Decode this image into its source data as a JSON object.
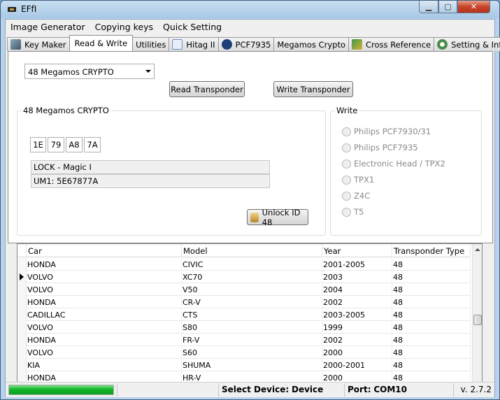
{
  "window": {
    "title": "EFfI"
  },
  "menu": {
    "items": [
      "Image Generator",
      "Copying keys",
      "Quick Setting"
    ]
  },
  "tabs": [
    {
      "label": "Key Maker",
      "icon": "keymaker-icon",
      "active": false
    },
    {
      "label": "Read & Write",
      "icon": "",
      "active": true
    },
    {
      "label": "Utilities",
      "icon": "",
      "active": false
    },
    {
      "label": "Hitag II",
      "icon": "hitag-icon",
      "active": false
    },
    {
      "label": "PCF7935",
      "icon": "pcf-icon",
      "active": false
    },
    {
      "label": "Megamos Crypto",
      "icon": "",
      "active": false
    },
    {
      "label": "Cross Reference",
      "icon": "cross-reference-icon",
      "active": false
    },
    {
      "label": "Setting & Info",
      "icon": "gear-icon",
      "active": false
    }
  ],
  "read_write": {
    "transponder_select": "48 Megamos CRYPTO",
    "read_button": "Read Transponder",
    "write_button": "Write Transponder",
    "info_group": {
      "title": "48 Megamos CRYPTO",
      "bytes": [
        "1E",
        "79",
        "A8",
        "7A"
      ],
      "lock": "LOCK - Magic I",
      "um": "UM1: 5E67877A",
      "unlock_button": "Unlock ID 48"
    },
    "write_group": {
      "title": "Write",
      "options": [
        "Philips PCF7930/31",
        "Philips PCF7935",
        "Electronic Head / TPX2",
        "TPX1",
        "Z4C",
        "T5"
      ]
    }
  },
  "table": {
    "headers": [
      "Car",
      "Model",
      "Year",
      "Transponder Type"
    ],
    "rows": [
      [
        "HONDA",
        "CIVIC",
        "2001-2005",
        "48"
      ],
      [
        "VOLVO",
        "XC70",
        "2003",
        "48"
      ],
      [
        "VOLVO",
        "V50",
        "2004",
        "48"
      ],
      [
        "HONDA",
        "CR-V",
        "2002",
        "48"
      ],
      [
        "CADILLAC",
        "CTS",
        "2003-2005",
        "48"
      ],
      [
        "VOLVO",
        "S80",
        "1999",
        "48"
      ],
      [
        "HONDA",
        "FR-V",
        "2002",
        "48"
      ],
      [
        "VOLVO",
        "S60",
        "2000",
        "48"
      ],
      [
        "KIA",
        "SHUMA",
        "2000-2001",
        "48"
      ],
      [
        "HONDA",
        "HR-V",
        "2000",
        "48"
      ]
    ],
    "selected_row": 1
  },
  "status": {
    "progress": 1.0,
    "select_device_label": "Select Device:",
    "device": "Device",
    "port_label": "Port:",
    "port": "COM10",
    "version": "v. 2.7.2"
  },
  "colors": {
    "progress": "#14b52a",
    "close": "#c6452a"
  }
}
